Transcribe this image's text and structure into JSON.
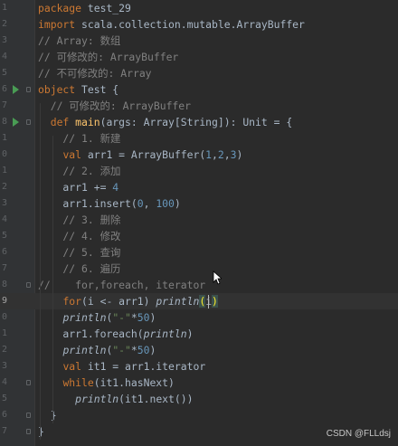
{
  "editor": {
    "lines": [
      {
        "n": "1",
        "tokens": [
          {
            "t": "package",
            "c": "kw"
          },
          {
            "t": " test_29",
            "c": ""
          }
        ]
      },
      {
        "n": "2",
        "tokens": [
          {
            "t": "import",
            "c": "kw"
          },
          {
            "t": " scala.collection.mutable.ArrayBuffer",
            "c": ""
          }
        ]
      },
      {
        "n": "3",
        "tokens": [
          {
            "t": "// Array: 数组",
            "c": "cm"
          }
        ]
      },
      {
        "n": "4",
        "tokens": [
          {
            "t": "// 可修改的: ArrayBuffer",
            "c": "cm"
          }
        ]
      },
      {
        "n": "5",
        "tokens": [
          {
            "t": "// 不可修改的: Array",
            "c": "cm"
          }
        ]
      },
      {
        "n": "6",
        "run": true,
        "tokens": [
          {
            "t": "object",
            "c": "kw"
          },
          {
            "t": " Test {",
            "c": ""
          }
        ]
      },
      {
        "n": "7",
        "tokens": [
          {
            "t": "  // 可修改的: ArrayBuffer",
            "c": "cm"
          }
        ]
      },
      {
        "n": "8",
        "run": true,
        "tokens": [
          {
            "t": "  ",
            "c": ""
          },
          {
            "t": "def",
            "c": "kw"
          },
          {
            "t": " ",
            "c": ""
          },
          {
            "t": "main",
            "c": "mf"
          },
          {
            "t": "(args: Array[String]): Unit = {",
            "c": ""
          }
        ]
      },
      {
        "n": "1",
        "tokens": [
          {
            "t": "    // 1. 新建",
            "c": "cm"
          }
        ]
      },
      {
        "n": "0",
        "tokens": [
          {
            "t": "    ",
            "c": ""
          },
          {
            "t": "val",
            "c": "kw"
          },
          {
            "t": " arr1 = ArrayBuffer(",
            "c": ""
          },
          {
            "t": "1",
            "c": "num"
          },
          {
            "t": ",",
            "c": ""
          },
          {
            "t": "2",
            "c": "num"
          },
          {
            "t": ",",
            "c": ""
          },
          {
            "t": "3",
            "c": "num"
          },
          {
            "t": ")",
            "c": ""
          }
        ]
      },
      {
        "n": "1",
        "tokens": [
          {
            "t": "    // 2. 添加",
            "c": "cm"
          }
        ]
      },
      {
        "n": "2",
        "tokens": [
          {
            "t": "    arr1 += ",
            "c": ""
          },
          {
            "t": "4",
            "c": "num"
          }
        ]
      },
      {
        "n": "3",
        "tokens": [
          {
            "t": "    arr1.insert(",
            "c": ""
          },
          {
            "t": "0",
            "c": "num"
          },
          {
            "t": ", ",
            "c": ""
          },
          {
            "t": "100",
            "c": "num"
          },
          {
            "t": ")",
            "c": ""
          }
        ]
      },
      {
        "n": "4",
        "tokens": [
          {
            "t": "    // 3. 删除",
            "c": "cm"
          }
        ]
      },
      {
        "n": "5",
        "tokens": [
          {
            "t": "    // 4. 修改",
            "c": "cm"
          }
        ]
      },
      {
        "n": "6",
        "tokens": [
          {
            "t": "    // 5. 查询",
            "c": "cm"
          }
        ]
      },
      {
        "n": "7",
        "tokens": [
          {
            "t": "    // 6. 遍历",
            "c": "cm"
          }
        ]
      },
      {
        "n": "8",
        "tokens": [
          {
            "t": "//    for,foreach, iterator",
            "c": "cm"
          }
        ]
      },
      {
        "n": "9",
        "current": true,
        "tokens": [
          {
            "t": "    ",
            "c": ""
          },
          {
            "t": "for",
            "c": "kw"
          },
          {
            "t": "(i <- arr1) ",
            "c": ""
          },
          {
            "t": "println",
            "c": "it"
          },
          {
            "t": "(",
            "c": "ph"
          },
          {
            "t": "i",
            "c": ""
          },
          {
            "t": ")",
            "c": "ph"
          }
        ]
      },
      {
        "n": "0",
        "tokens": [
          {
            "t": "    ",
            "c": ""
          },
          {
            "t": "println",
            "c": "it"
          },
          {
            "t": "(",
            "c": ""
          },
          {
            "t": "\"-\"",
            "c": "str"
          },
          {
            "t": "*",
            "c": ""
          },
          {
            "t": "50",
            "c": "num"
          },
          {
            "t": ")",
            "c": ""
          }
        ]
      },
      {
        "n": "1",
        "tokens": [
          {
            "t": "    arr1.foreach(",
            "c": ""
          },
          {
            "t": "println",
            "c": "it"
          },
          {
            "t": ")",
            "c": ""
          }
        ]
      },
      {
        "n": "2",
        "tokens": [
          {
            "t": "    ",
            "c": ""
          },
          {
            "t": "println",
            "c": "it"
          },
          {
            "t": "(",
            "c": ""
          },
          {
            "t": "\"-\"",
            "c": "str"
          },
          {
            "t": "*",
            "c": ""
          },
          {
            "t": "50",
            "c": "num"
          },
          {
            "t": ")",
            "c": ""
          }
        ]
      },
      {
        "n": "3",
        "tokens": [
          {
            "t": "    ",
            "c": ""
          },
          {
            "t": "val",
            "c": "kw"
          },
          {
            "t": " it1 = arr1.iterator",
            "c": ""
          }
        ]
      },
      {
        "n": "4",
        "tokens": [
          {
            "t": "    ",
            "c": ""
          },
          {
            "t": "while",
            "c": "kw"
          },
          {
            "t": "(it1.hasNext)",
            "c": ""
          }
        ]
      },
      {
        "n": "5",
        "tokens": [
          {
            "t": "      ",
            "c": ""
          },
          {
            "t": "println",
            "c": "it"
          },
          {
            "t": "(it1.next())",
            "c": ""
          }
        ]
      },
      {
        "n": "6",
        "tokens": [
          {
            "t": "  }",
            "c": ""
          }
        ]
      },
      {
        "n": "7",
        "tokens": [
          {
            "t": "}",
            "c": ""
          }
        ]
      }
    ]
  },
  "watermark": "CSDN @FLLdsj",
  "colors": {
    "background": "#2b2b2b",
    "keyword": "#cc7832",
    "comment": "#808080",
    "number": "#6897bb",
    "string": "#6a8759",
    "run_icon": "#499c54"
  },
  "icons": {
    "run": "run-gutter-icon",
    "fold": "fold-marker-icon",
    "pointer": "mouse-pointer-icon"
  }
}
